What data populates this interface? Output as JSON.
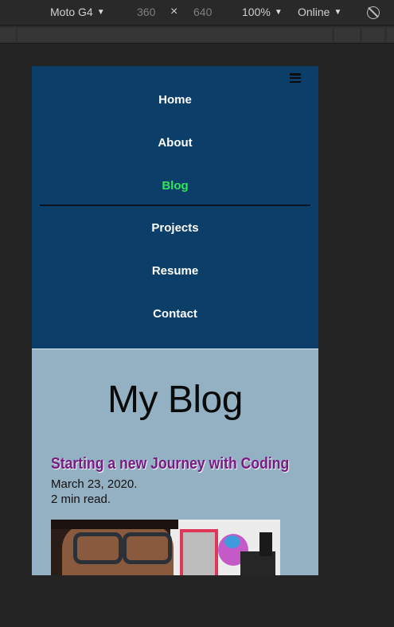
{
  "devtools": {
    "device": "Moto G4",
    "width": "360",
    "times": "×",
    "height": "640",
    "zoom": "100%",
    "network": "Online",
    "caret": "▼",
    "rotate_icon": "rotate-icon"
  },
  "nav": {
    "menu_icon": "hamburger-menu-icon",
    "items": [
      {
        "label": "Home"
      },
      {
        "label": "About"
      },
      {
        "label": "Blog",
        "active": true
      },
      {
        "label": "Projects"
      },
      {
        "label": "Resume"
      },
      {
        "label": "Contact"
      }
    ],
    "active_color": "#2ee55c",
    "background": "#0b3f6a"
  },
  "main": {
    "title": "My Blog",
    "background": "#94b1c4",
    "posts": [
      {
        "title": "Starting a new Journey with Coding",
        "date": "March 23, 2020.",
        "read_time": "2 min read.",
        "title_color": "#7a1a82"
      }
    ]
  }
}
